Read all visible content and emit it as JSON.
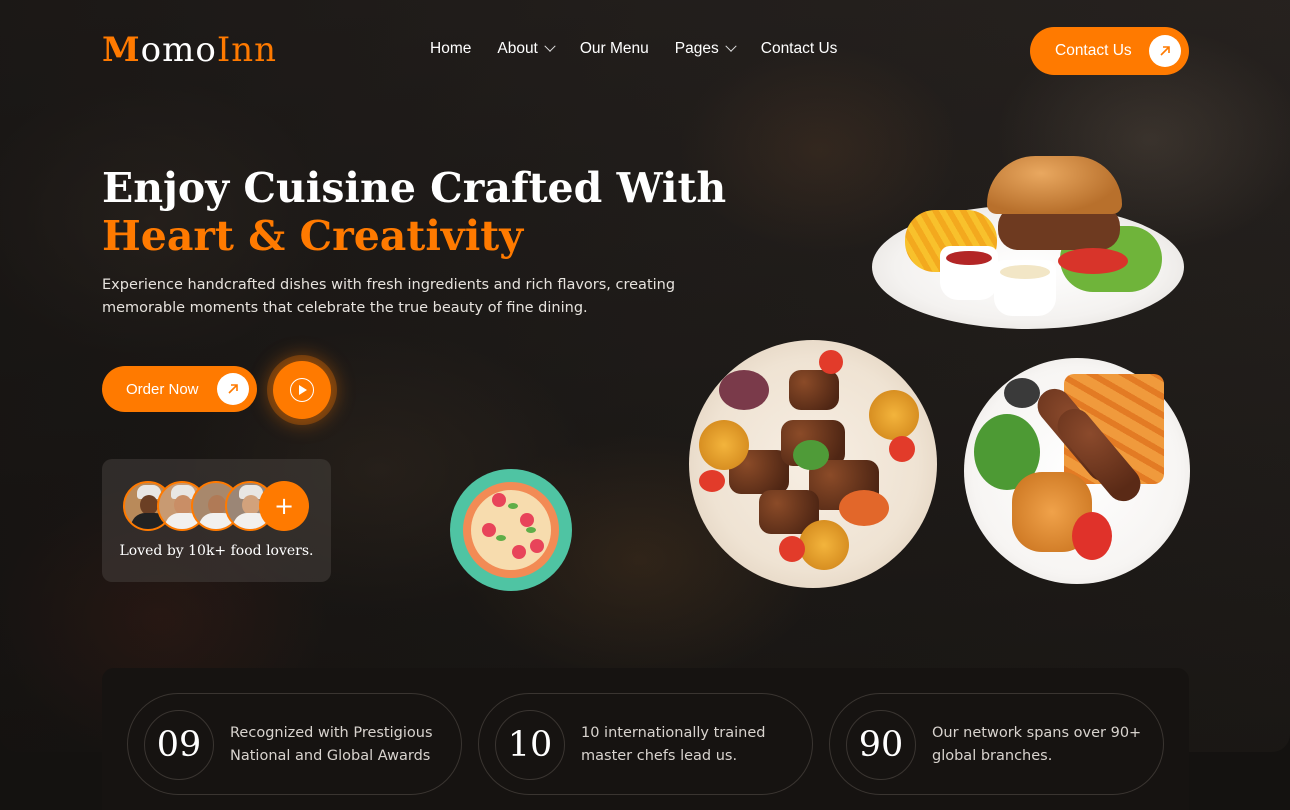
{
  "brand": {
    "mark": "M",
    "name_main": "omo",
    "name_accent": "Inn"
  },
  "nav": {
    "items": [
      {
        "label": "Home",
        "has_dropdown": false
      },
      {
        "label": "About",
        "has_dropdown": true
      },
      {
        "label": "Our Menu",
        "has_dropdown": false
      },
      {
        "label": "Pages",
        "has_dropdown": true
      },
      {
        "label": "Contact Us",
        "has_dropdown": false
      }
    ],
    "cta_label": "Contact Us"
  },
  "hero": {
    "title_line1": "Enjoy Cuisine Crafted With",
    "title_line2": "Heart & Creativity",
    "description": "Experience handcrafted dishes with fresh ingredients and rich flavors, creating memorable moments that celebrate the true beauty of fine dining.",
    "order_label": "Order Now",
    "lovers_text": "Loved by 10k+ food lovers.",
    "add_symbol": "+"
  },
  "stats": [
    {
      "number": "09",
      "text": "Recognized with Prestigious National and Global Awards"
    },
    {
      "number": "10",
      "text": "10 internationally trained master chefs lead us."
    },
    {
      "number": "90",
      "text": "Our network spans over 90+ global branches."
    }
  ],
  "colors": {
    "accent": "#ff7a00",
    "background": "#141210",
    "text": "#ffffff"
  },
  "icons": [
    "arrow-up-right-icon",
    "play-icon",
    "chevron-down-icon",
    "plus-icon"
  ]
}
